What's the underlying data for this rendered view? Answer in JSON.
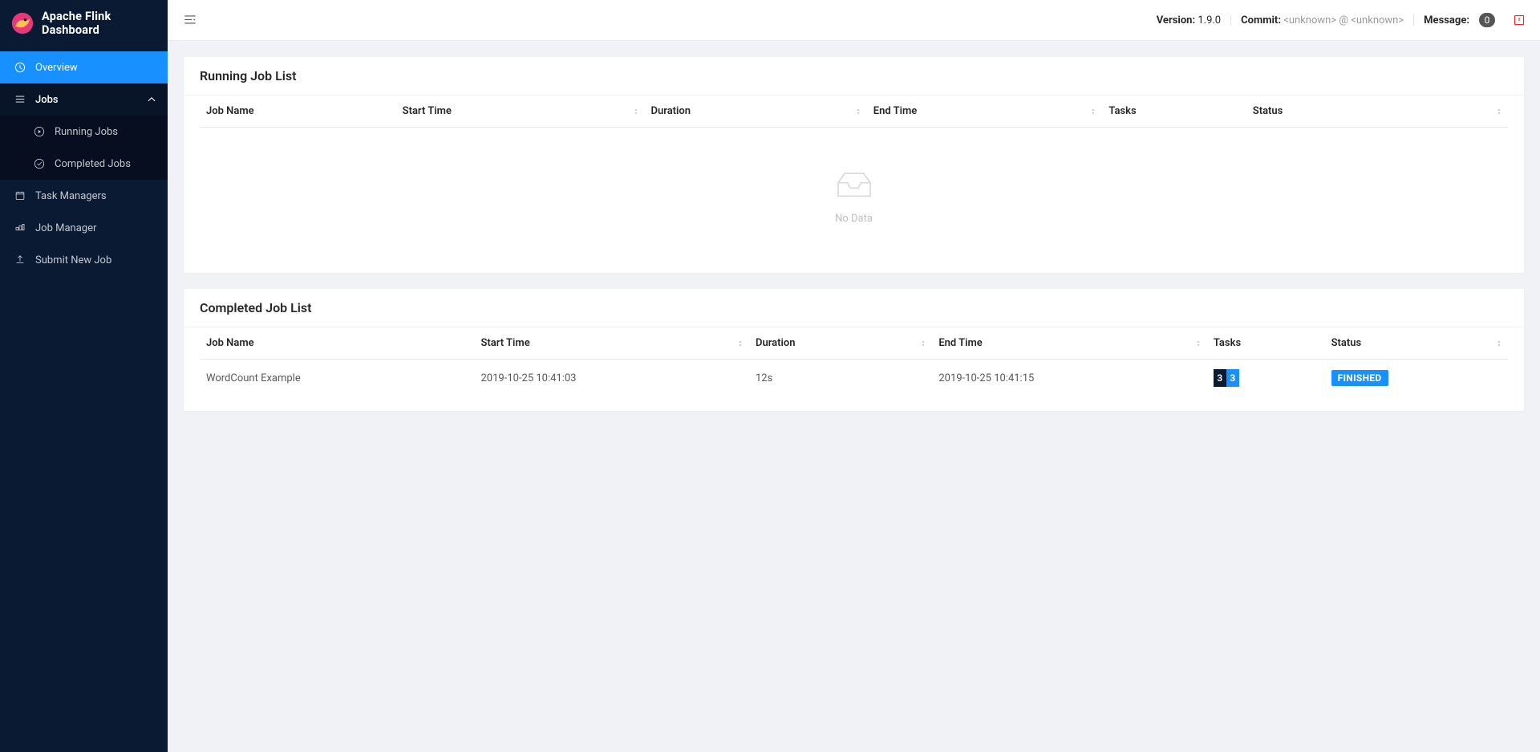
{
  "app": {
    "title": "Apache Flink Dashboard"
  },
  "sidebar": {
    "items": [
      {
        "label": "Overview",
        "name": "sidebar-item-overview",
        "icon": "dashboard-icon",
        "active": true
      },
      {
        "label": "Jobs",
        "name": "sidebar-item-jobs",
        "icon": "bars-icon",
        "expanded": true,
        "children": [
          {
            "label": "Running Jobs",
            "name": "sidebar-subitem-running-jobs",
            "icon": "play-circle-icon"
          },
          {
            "label": "Completed Jobs",
            "name": "sidebar-subitem-completed-jobs",
            "icon": "check-circle-icon"
          }
        ]
      },
      {
        "label": "Task Managers",
        "name": "sidebar-item-task-managers",
        "icon": "schedule-icon"
      },
      {
        "label": "Job Manager",
        "name": "sidebar-item-job-manager",
        "icon": "build-icon"
      },
      {
        "label": "Submit New Job",
        "name": "sidebar-item-submit-new-job",
        "icon": "upload-icon"
      }
    ]
  },
  "topbar": {
    "version_label": "Version:",
    "version_value": "1.9.0",
    "commit_label": "Commit:",
    "commit_left": "<unknown>",
    "commit_sep": "@",
    "commit_right": "<unknown>",
    "message_label": "Message:",
    "message_count": "0"
  },
  "running_panel": {
    "title": "Running Job List",
    "columns": [
      "Job Name",
      "Start Time",
      "Duration",
      "End Time",
      "Tasks",
      "Status"
    ],
    "empty_text": "No Data",
    "rows": []
  },
  "completed_panel": {
    "title": "Completed Job List",
    "columns": [
      "Job Name",
      "Start Time",
      "Duration",
      "End Time",
      "Tasks",
      "Status"
    ],
    "rows": [
      {
        "job_name": "WordCount Example",
        "start_time": "2019-10-25 10:41:03",
        "duration": "12s",
        "end_time": "2019-10-25 10:41:15",
        "tasks_a": "3",
        "tasks_b": "3",
        "status": "FINISHED"
      }
    ]
  }
}
